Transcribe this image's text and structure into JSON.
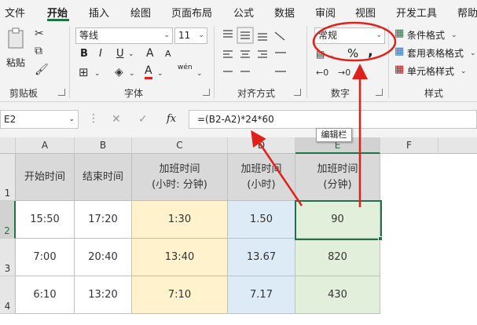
{
  "tabs": [
    "文件",
    "开始",
    "插入",
    "绘图",
    "页面布局",
    "公式",
    "数据",
    "审阅",
    "视图",
    "开发工具",
    "帮助"
  ],
  "ribbon": {
    "clipboard": {
      "paste_label": "粘贴",
      "group_label": "剪贴板"
    },
    "font": {
      "font_name": "等线",
      "font_size": "11",
      "bold": "B",
      "italic": "I",
      "underline": "U",
      "grow": "A",
      "shrink": "A",
      "font_color": "A",
      "phonetic": "wén",
      "group_label": "字体"
    },
    "alignment": {
      "group_label": "对齐方式"
    },
    "number": {
      "format_value": "常规",
      "percent": "%",
      "comma": ",",
      "group_label": "数字"
    },
    "styles": {
      "conditional": "条件格式",
      "table": "套用表格格式",
      "cell_styles": "单元格样式",
      "group_label": "样式"
    }
  },
  "formula_bar": {
    "name_box": "E2",
    "fx": "fx",
    "formula": "=(B2-A2)*24*60",
    "tooltip": "编辑栏"
  },
  "sheet": {
    "columns": [
      "A",
      "B",
      "C",
      "D",
      "E",
      "F"
    ],
    "rows": [
      "1",
      "2",
      "3",
      "4"
    ],
    "header_row": [
      "开始时间",
      "结束时间",
      "加班时间\n(小时: 分钟)",
      "加班时间\n(小时)",
      "加班时间\n(分钟)"
    ],
    "data": [
      [
        "15:50",
        "17:20",
        "1:30",
        "1.50",
        "90"
      ],
      [
        "7:00",
        "20:40",
        "13:40",
        "13.67",
        "820"
      ],
      [
        "6:10",
        "13:20",
        "7:10",
        "7.17",
        "430"
      ]
    ],
    "selected_cell": "E2"
  },
  "colors": {
    "accent": "#217346",
    "annotation": "#e0201b",
    "yellow_fill": "#fff2cc",
    "blue_fill": "#ddebf7",
    "green_fill": "#e2efda",
    "header_fill": "#d9d9d9"
  }
}
